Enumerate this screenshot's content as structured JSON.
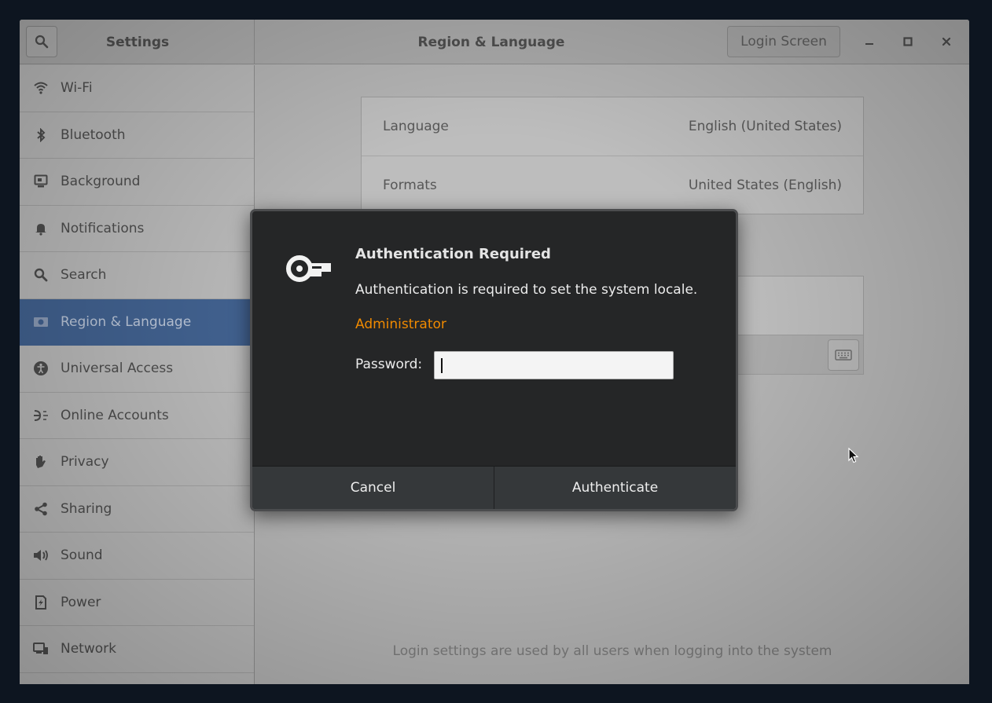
{
  "window": {
    "sidebar_title": "Settings",
    "main_title": "Region & Language",
    "login_screen_label": "Login Screen"
  },
  "sidebar": {
    "items": [
      {
        "label": "Wi-Fi",
        "icon": "wifi-icon"
      },
      {
        "label": "Bluetooth",
        "icon": "bluetooth-icon"
      },
      {
        "label": "Background",
        "icon": "background-icon"
      },
      {
        "label": "Notifications",
        "icon": "bell-icon"
      },
      {
        "label": "Search",
        "icon": "search-icon"
      },
      {
        "label": "Region & Language",
        "icon": "flag-icon",
        "active": true
      },
      {
        "label": "Universal Access",
        "icon": "accessibility-icon"
      },
      {
        "label": "Online Accounts",
        "icon": "online-accounts-icon"
      },
      {
        "label": "Privacy",
        "icon": "hand-icon"
      },
      {
        "label": "Sharing",
        "icon": "share-icon"
      },
      {
        "label": "Sound",
        "icon": "speaker-icon"
      },
      {
        "label": "Power",
        "icon": "power-icon"
      },
      {
        "label": "Network",
        "icon": "network-icon"
      }
    ]
  },
  "region": {
    "rows": [
      {
        "label": "Language",
        "value": "English (United States)"
      },
      {
        "label": "Formats",
        "value": "United States (English)"
      }
    ],
    "footer_note": "Login settings are used by all users when logging into the system"
  },
  "dialog": {
    "title": "Authentication Required",
    "message": "Authentication is required to set the system locale.",
    "user": "Administrator",
    "password_label": "Password:",
    "password_value": "",
    "cancel_label": "Cancel",
    "authenticate_label": "Authenticate"
  },
  "colors": {
    "accent": "#41618f",
    "user_orange": "#f08a00",
    "dialog_bg": "#252627"
  }
}
